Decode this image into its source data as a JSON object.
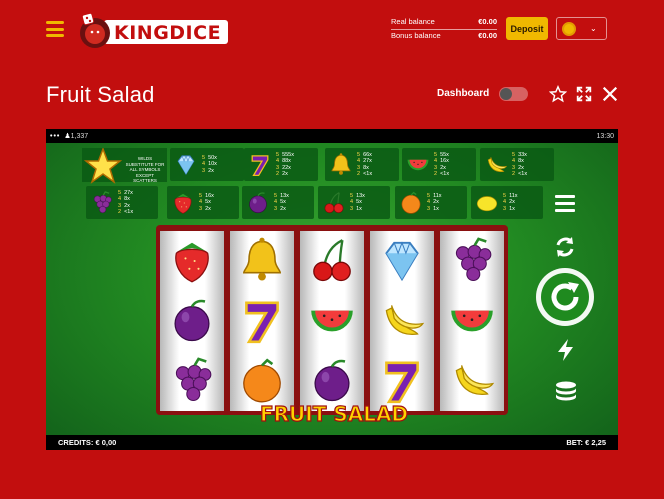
{
  "header": {
    "brand": "KINGDICE",
    "real_balance_label": "Real balance",
    "real_balance_value": "€0.00",
    "bonus_balance_label": "Bonus balance",
    "bonus_balance_value": "€0.00",
    "deposit_label": "Deposit",
    "language_icon": "flag-icon"
  },
  "page": {
    "title": "Fruit Salad",
    "dashboard_label": "Dashboard",
    "dashboard_on": false
  },
  "game": {
    "players": "1,337",
    "time": "13:30",
    "credits": "CREDITS: € 0,00",
    "bet": "BET: € 2,25",
    "logo_text": "FRUIT SALAD",
    "wild_text": "WILDS SUBSTITUTE FOR ALL SYMBOLS EXCEPT SCATTERS",
    "paytable_row1": [
      {
        "symbol": "diamond",
        "p5": "50x",
        "p4": "10x",
        "p3": "2x"
      },
      {
        "symbol": "seven",
        "p5": "555x",
        "p4": "88x",
        "p3": "22x",
        "p2": "2x"
      },
      {
        "symbol": "bell",
        "p5": "66x",
        "p4": "27x",
        "p3": "8x",
        "p2": "<1x"
      },
      {
        "symbol": "watermelon",
        "p5": "55x",
        "p4": "16x",
        "p3": "2x",
        "p2": "<1x"
      },
      {
        "symbol": "banana",
        "p5": "33x",
        "p4": "8x",
        "p3": "2x",
        "p2": "<1x"
      }
    ],
    "paytable_row2": [
      {
        "symbol": "grapes",
        "p5": "27x",
        "p4": "8x",
        "p3": "2x",
        "p2": "<1x"
      },
      {
        "symbol": "strawberry",
        "p5": "16x",
        "p4": "5x",
        "p3": "2x"
      },
      {
        "symbol": "plum",
        "p5": "13x",
        "p4": "5x",
        "p3": "2x"
      },
      {
        "symbol": "cherry",
        "p5": "13x",
        "p4": "5x",
        "p3": "1x"
      },
      {
        "symbol": "orange",
        "p5": "11x",
        "p4": "2x",
        "p3": "1x"
      },
      {
        "symbol": "lemon",
        "p5": "11x",
        "p4": "2x",
        "p3": "1x"
      }
    ],
    "reels": [
      [
        "strawberry",
        "plum",
        "grapes"
      ],
      [
        "bell",
        "seven",
        "orange"
      ],
      [
        "cherry",
        "watermelon",
        "plum"
      ],
      [
        "diamond",
        "banana",
        "seven"
      ],
      [
        "grapes",
        "watermelon",
        "banana"
      ]
    ]
  },
  "colors": {
    "page_bg": "#c20e0e",
    "accent": "#f0b800",
    "felt": "#228b22"
  }
}
